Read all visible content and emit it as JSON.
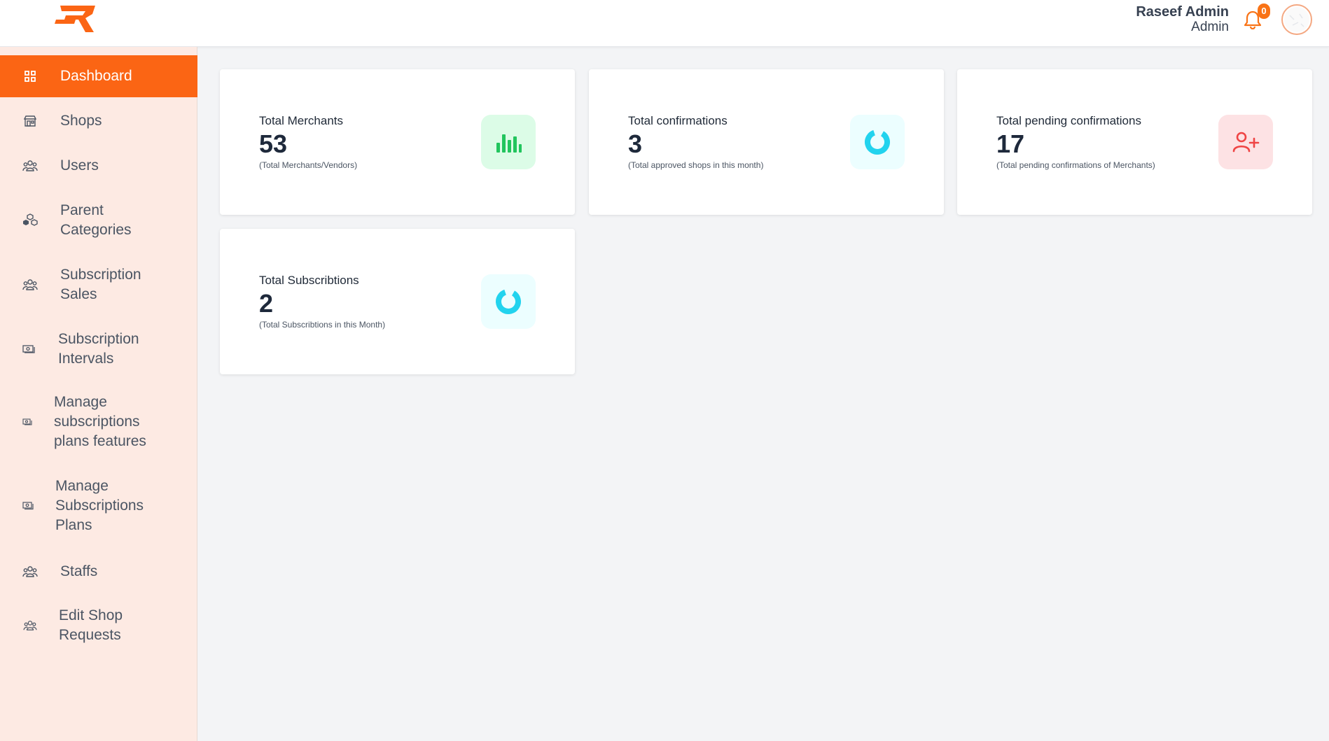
{
  "header": {
    "user_name": "Raseef Admin",
    "user_role": "Admin",
    "notification_count": "0",
    "brand_color": "#fb6514"
  },
  "sidebar": {
    "items": [
      {
        "label": "Dashboard",
        "icon": "grid-icon",
        "active": true
      },
      {
        "label": "Shops",
        "icon": "store-icon"
      },
      {
        "label": "Users",
        "icon": "users-icon"
      },
      {
        "label": "Parent\nCategories",
        "icon": "cubes-icon"
      },
      {
        "label": "Subscription\nSales",
        "icon": "users-icon"
      },
      {
        "label": "Subscription\nIntervals",
        "icon": "money-icon"
      },
      {
        "label": "Manage\nsubscriptions\nplans features",
        "icon": "money-icon"
      },
      {
        "label": "Manage\nSubscriptions\nPlans",
        "icon": "money-icon"
      },
      {
        "label": "Staffs",
        "icon": "users-icon"
      },
      {
        "label": "Edit Shop\nRequests",
        "icon": "users-icon"
      }
    ]
  },
  "cards": [
    {
      "title": "Total Merchants",
      "value": "53",
      "subtitle": "(Total Merchants/Vendors)",
      "icon": "bar-chart-icon",
      "icon_color": "#22c55e",
      "icon_bg": "#dcfce7"
    },
    {
      "title": "Total confirmations",
      "value": "3",
      "subtitle": "(Total approved shops in this month)",
      "icon": "donut-icon",
      "icon_color": "#22d3ee",
      "icon_bg": "#ecfeff"
    },
    {
      "title": "Total pending confirmations",
      "value": "17",
      "subtitle": "(Total pending confirmations of Merchants)",
      "icon": "user-plus-icon",
      "icon_color": "#ef4444",
      "icon_bg": "#fde2e4"
    },
    {
      "title": "Total Subscribtions",
      "value": "2",
      "subtitle": "(Total Subscribtions in this Month)",
      "icon": "donut-icon",
      "icon_color": "#22d3ee",
      "icon_bg": "#ecfeff"
    }
  ]
}
